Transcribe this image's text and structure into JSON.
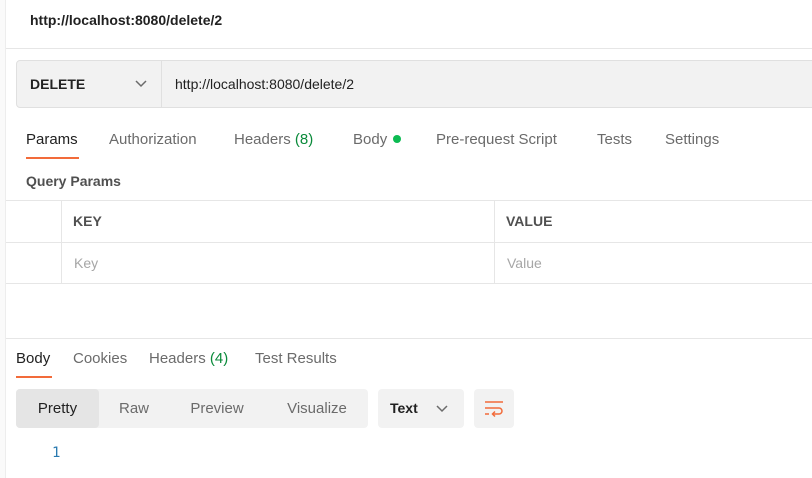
{
  "request": {
    "title": "http://localhost:8080/delete/2",
    "method": "DELETE",
    "url": "http://localhost:8080/delete/2"
  },
  "request_tabs": [
    {
      "label": "Params",
      "active": true
    },
    {
      "label": "Authorization"
    },
    {
      "label": "Headers",
      "count": "(8)"
    },
    {
      "label": "Body",
      "indicator": "green-dot"
    },
    {
      "label": "Pre-request Script"
    },
    {
      "label": "Tests"
    },
    {
      "label": "Settings"
    }
  ],
  "query_params": {
    "label": "Query Params",
    "columns": {
      "key": "KEY",
      "value": "VALUE"
    },
    "placeholders": {
      "key": "Key",
      "value": "Value"
    }
  },
  "response_tabs": [
    {
      "label": "Body",
      "active": true
    },
    {
      "label": "Cookies"
    },
    {
      "label": "Headers",
      "count": "(4)"
    },
    {
      "label": "Test Results"
    }
  ],
  "response_view": {
    "modes": [
      "Pretty",
      "Raw",
      "Preview",
      "Visualize"
    ],
    "active_mode": "Pretty",
    "format": "Text",
    "wrap_icon": "wrap-lines-icon"
  },
  "response_body": {
    "line_numbers": [
      "1"
    ]
  },
  "colors": {
    "accent": "#f26b3a",
    "count_green": "#0a8a3a",
    "status_dot": "#0cbb52",
    "line_number": "#2a7ab0"
  }
}
